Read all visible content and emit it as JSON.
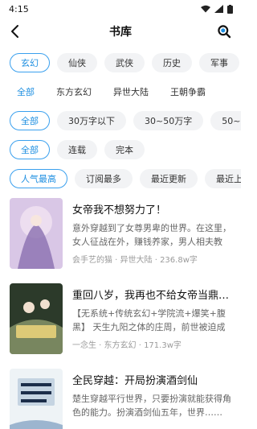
{
  "status": {
    "time": "4:15"
  },
  "header": {
    "title": "书库"
  },
  "filters": {
    "genres": [
      {
        "label": "玄幻",
        "active": true
      },
      {
        "label": "仙侠",
        "active": false
      },
      {
        "label": "武侠",
        "active": false
      },
      {
        "label": "历史",
        "active": false
      },
      {
        "label": "军事",
        "active": false
      }
    ],
    "subgenres": [
      {
        "label": "全部",
        "active": true
      },
      {
        "label": "东方玄幻",
        "active": false
      },
      {
        "label": "异世大陆",
        "active": false
      },
      {
        "label": "王朝争霸",
        "active": false
      }
    ],
    "wordcount": [
      {
        "label": "全部",
        "active": true
      },
      {
        "label": "30万字以下",
        "active": false
      },
      {
        "label": "30~50万字",
        "active": false
      },
      {
        "label": "50~100万",
        "active": false
      }
    ],
    "status": [
      {
        "label": "全部",
        "active": true
      },
      {
        "label": "连载",
        "active": false
      },
      {
        "label": "完本",
        "active": false
      }
    ],
    "sort": [
      {
        "label": "人气最高",
        "active": true
      },
      {
        "label": "订阅最多",
        "active": false
      },
      {
        "label": "最近更新",
        "active": false
      },
      {
        "label": "最近上架",
        "active": false
      }
    ]
  },
  "books": [
    {
      "title": "女帝我不想努力了！",
      "desc": "意外穿越到了女尊男卑的世界。在这里，女人征战在外，赚钱养家，男人相夫教子……",
      "meta": "会手艺的猫 · 异世大陆 · 236.8w字",
      "cover_colors": [
        "#d9c7e6",
        "#8a6fb0",
        "#f1e3f3"
      ]
    },
    {
      "title": "重回八岁，我再也不给女帝当鼎炉了",
      "desc": "【无系统+传统玄幻+学院流+爆笑+腹黑】 天生九阳之体的庄周，前世被迫成为女帝的鼎炉……",
      "meta": "一念生 · 东方玄幻 · 171.3w字",
      "cover_colors": [
        "#2c3a2a",
        "#b8c48a",
        "#e8d27a"
      ]
    },
    {
      "title": "全民穿越：开局扮演酒剑仙",
      "desc": "楚生穿越平行世界，只要扮演就能获得角色的能力。扮演酒剑仙五年，世界……",
      "meta": "",
      "cover_colors": [
        "#eef3f6",
        "#4a78a8",
        "#1c2e4a"
      ]
    }
  ]
}
